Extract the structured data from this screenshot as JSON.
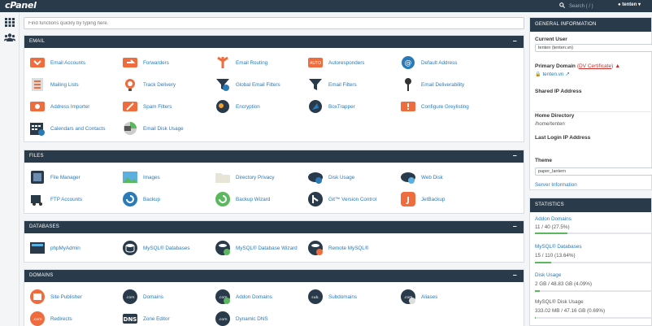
{
  "topbar": {
    "logo": "cPanel",
    "search_placeholder": "Search ( / )",
    "user": "tenten"
  },
  "quick_search": {
    "placeholder": "Find functions quickly by typing here."
  },
  "email": {
    "title": "EMAIL",
    "items": [
      "Email Accounts",
      "Forwarders",
      "Email Routing",
      "Autoresponders",
      "Default Address",
      "Mailing Lists",
      "Track Delivery",
      "Global Email Filters",
      "Email Filters",
      "Email Deliverability",
      "Address Importer",
      "Spam Filters",
      "Encryption",
      "BoxTrapper",
      "Configure Greylisting",
      "Calendars and Contacts",
      "Email Disk Usage"
    ]
  },
  "files": {
    "title": "FILES",
    "items": [
      "File Manager",
      "Images",
      "Directory Privacy",
      "Disk Usage",
      "Web Disk",
      "FTP Accounts",
      "Backup",
      "Backup Wizard",
      "Git™ Version Control",
      "JetBackup"
    ]
  },
  "databases": {
    "title": "DATABASES",
    "items": [
      "phpMyAdmin",
      "MySQL® Databases",
      "MySQL® Database Wizard",
      "Remote MySQL®"
    ]
  },
  "domains": {
    "title": "DOMAINS",
    "items": [
      "Site Publisher",
      "Domains",
      "Addon Domains",
      "Subdomains",
      "Aliases",
      "Redirects",
      "Zone Editor",
      "Dynamic DNS"
    ]
  },
  "general": {
    "title": "GENERAL INFORMATION",
    "current_user_label": "Current User",
    "current_user": "tenten (tenten.vn)",
    "primary_domain_label": "Primary Domain",
    "cert_link": "DV Certificate",
    "domain": "tenten.vn",
    "shared_ip_label": "Shared IP Address",
    "home_dir_label": "Home Directory",
    "home_dir": "/home/tenten",
    "last_login_label": "Last Login IP Address",
    "theme_label": "Theme",
    "theme": "paper_lantern",
    "server_info": "Server Information"
  },
  "statistics": {
    "title": "STATISTICS",
    "items": [
      {
        "label": "Addon Domains",
        "value": "11 / 40   (27.5%)",
        "fraction": 0.275
      },
      {
        "label": "MySQL® Databases",
        "value": "15 / 110   (13.64%)",
        "fraction": 0.1364
      },
      {
        "label": "Disk Usage",
        "value": "2 GB / 48.83 GB   (4.09%)",
        "fraction": 0.0409
      },
      {
        "label": "MySQL® Disk Usage",
        "value": "333.02 MB / 47.16 GB   (0.69%)",
        "fraction": 0.0069
      }
    ]
  },
  "colors": {
    "header": "#293a4a",
    "link": "#2a7ab8",
    "accent_orange": "#ef6c3e",
    "bar_fill": "#5cb85c"
  }
}
